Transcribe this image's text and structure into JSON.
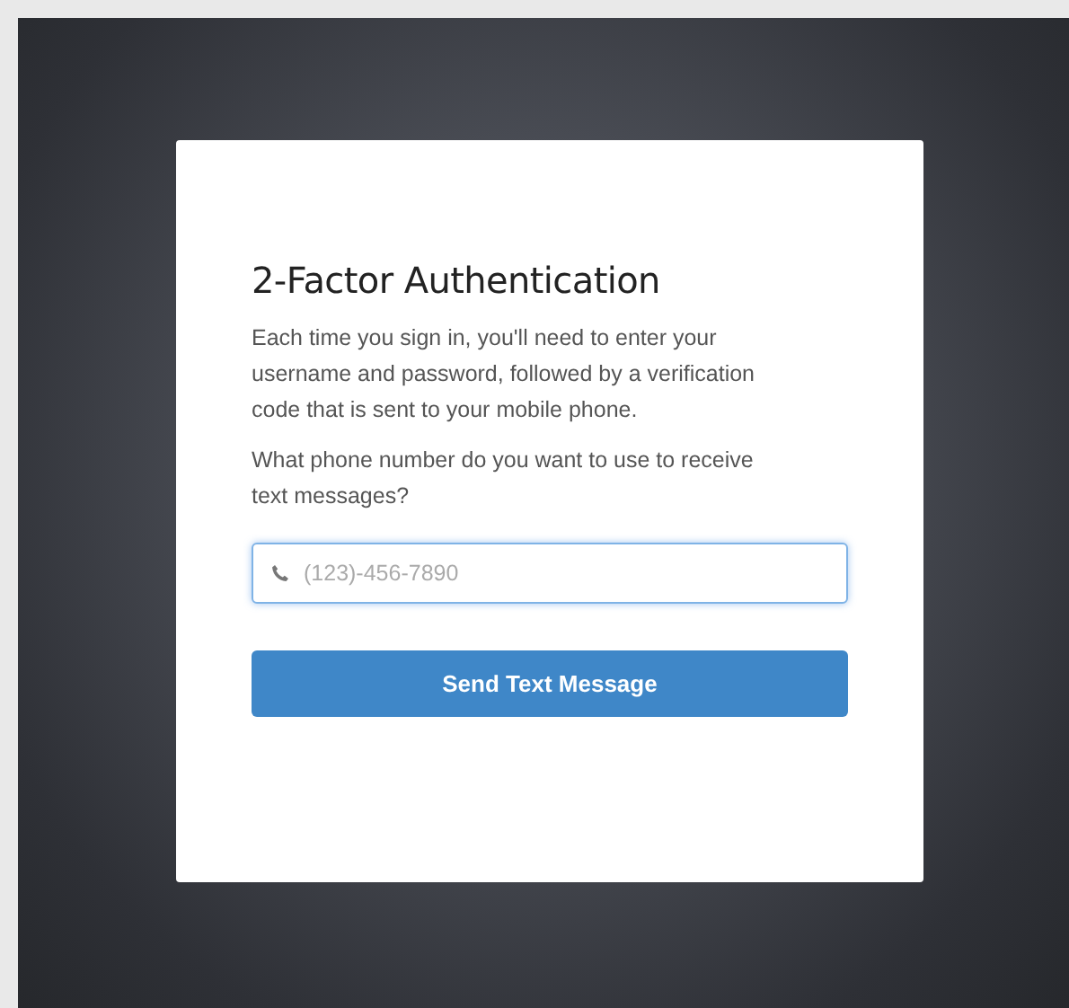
{
  "dialog": {
    "title": "2-Factor Authentication",
    "description": "Each time you sign in, you'll need to enter your username and password, followed by a verification code that is sent to your mobile phone.",
    "question": "What phone number do you want to use to receive text messages?",
    "phone_field": {
      "placeholder": "(123)-456-7890",
      "focused": true
    },
    "button": "Send Text Message"
  }
}
